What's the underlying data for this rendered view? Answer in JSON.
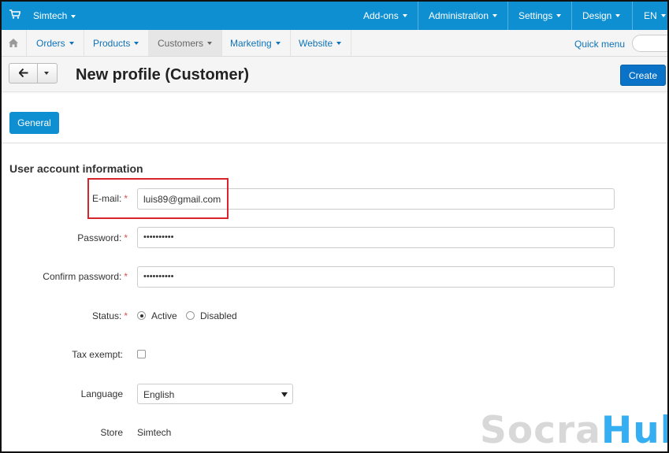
{
  "topbar": {
    "brand": "Simtech",
    "menu": [
      "Add-ons",
      "Administration",
      "Settings",
      "Design",
      "EN"
    ]
  },
  "nav": {
    "items": [
      "Orders",
      "Products",
      "Customers",
      "Marketing",
      "Website"
    ],
    "active": "Customers",
    "quick_menu": "Quick menu"
  },
  "header": {
    "title": "New profile (Customer)",
    "create_label": "Create"
  },
  "tabs": [
    "General"
  ],
  "form": {
    "section_title": "User account information",
    "email_label": "E-mail:",
    "email_value": "luis89@gmail.com",
    "password_label": "Password:",
    "password_value": "••••••••••",
    "confirm_label": "Confirm password:",
    "confirm_value": "••••••••••",
    "status_label": "Status:",
    "status_options": [
      "Active",
      "Disabled"
    ],
    "status_selected": "Active",
    "tax_label": "Tax exempt:",
    "tax_checked": false,
    "language_label": "Language",
    "language_value": "English",
    "store_label": "Store",
    "store_value": "Simtech"
  },
  "watermark": {
    "part1": "Socra",
    "part2": "Hub"
  },
  "colors": {
    "topbar": "#0e8fd1",
    "link": "#0e73b8",
    "primary_button": "#0a73c8",
    "highlight_box": "#d8242b",
    "required": "#d9534f"
  }
}
